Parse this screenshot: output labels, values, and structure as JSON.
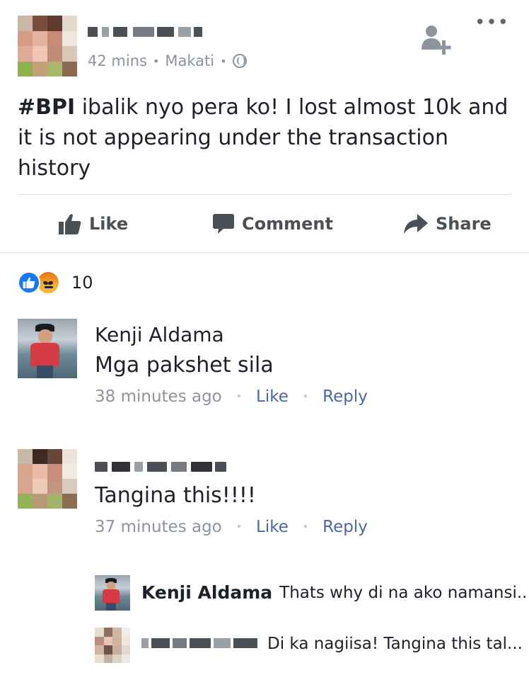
{
  "post": {
    "time": "42 mins",
    "location": "Makati",
    "hashtag": "#BPI",
    "text": " ibalik nyo pera ko! I lost almost 10k and it is not appearing under the transaction history",
    "more_label": "•••"
  },
  "actions": {
    "like": "Like",
    "comment": "Comment",
    "share": "Share"
  },
  "reactions": {
    "count": "10",
    "types": [
      "like",
      "angry"
    ]
  },
  "comments": [
    {
      "name": "Kenji Aldama",
      "text": "Mga pakshet sila",
      "time": "38 minutes ago",
      "like": "Like",
      "reply": "Reply"
    },
    {
      "text": "Tangina this!!!!",
      "time": "37 minutes ago",
      "like": "Like",
      "reply": "Reply"
    }
  ],
  "replies": [
    {
      "name": "Kenji Aldama",
      "text": "Thats why di na ako namansi..."
    },
    {
      "text": "Di ka nagiisa! Tangina this tal..."
    }
  ],
  "colors": {
    "brand_blue": "#1877f2",
    "link": "#4b6aa0",
    "meta_gray": "#8d949e",
    "text": "#1d2129"
  }
}
